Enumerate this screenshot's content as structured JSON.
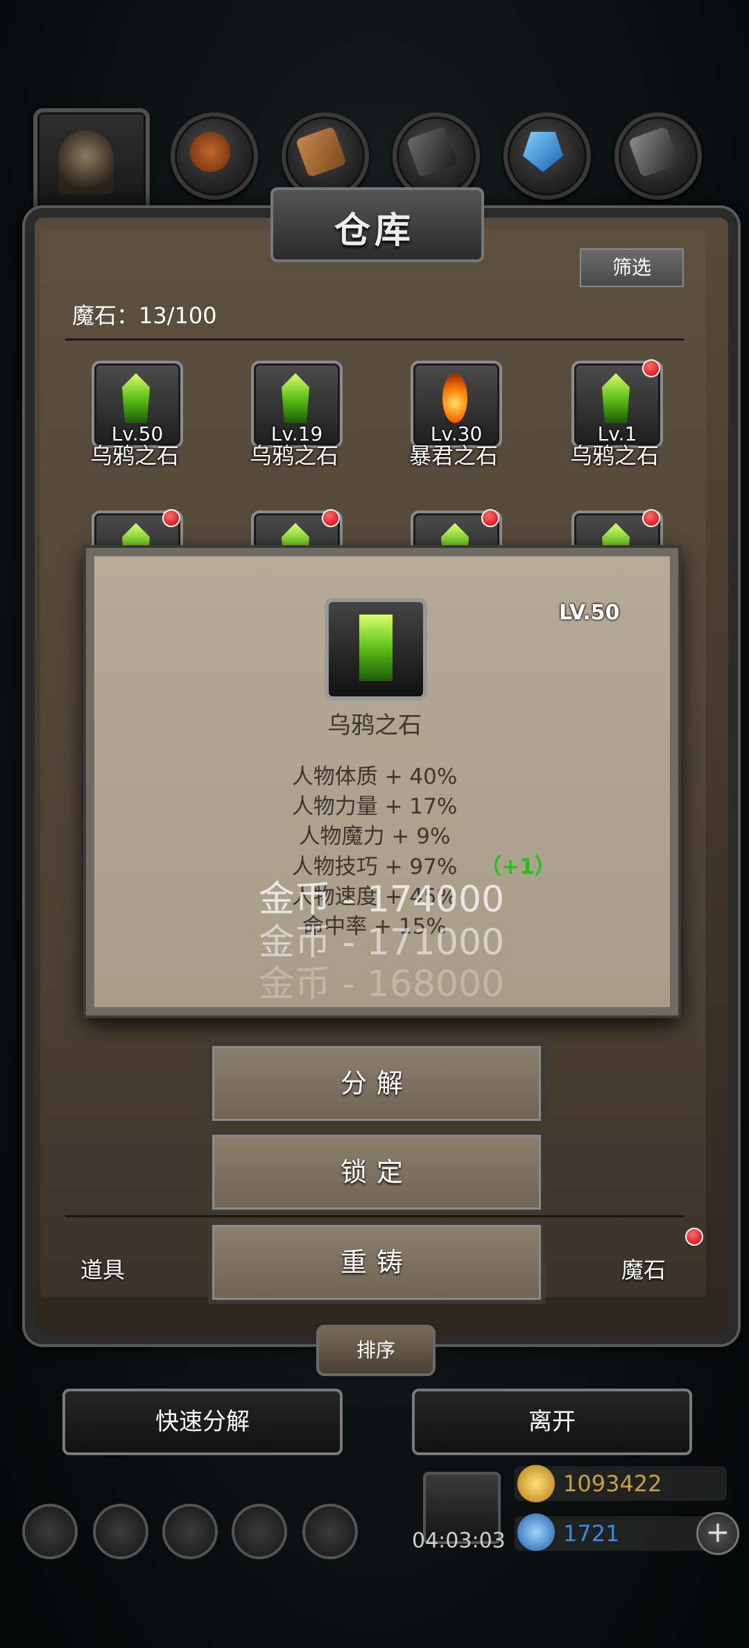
{
  "window": {
    "title": "仓库",
    "filter_label": "筛选"
  },
  "inventory": {
    "count_label": "魔石：13/100"
  },
  "top_tabs": [
    {
      "icon": "helmet-icon"
    },
    {
      "icon": "bread-icon"
    },
    {
      "icon": "wood-icon"
    },
    {
      "icon": "iron-icon"
    },
    {
      "icon": "crystal-icon"
    },
    {
      "icon": "steel-icon"
    }
  ],
  "stones_row1": [
    {
      "lvl": "Lv.50",
      "name": "乌鸦之石",
      "type": "green",
      "new": false
    },
    {
      "lvl": "Lv.19",
      "name": "乌鸦之石",
      "type": "green",
      "new": false
    },
    {
      "lvl": "Lv.30",
      "name": "暴君之石",
      "type": "fire",
      "new": false
    },
    {
      "lvl": "Lv.1",
      "name": "乌鸦之石",
      "type": "green",
      "new": true
    }
  ],
  "stones_row2": [
    {
      "type": "green",
      "new": true
    },
    {
      "type": "green",
      "new": true
    },
    {
      "type": "green",
      "new": true
    },
    {
      "type": "green",
      "new": true
    }
  ],
  "detail": {
    "level": "LV.50",
    "name": "乌鸦之石",
    "stats": [
      "人物体质 + 40%",
      "人物力量 + 17%",
      "人物魔力 + 9%",
      "人物技巧 + 97%",
      "人物速度 + 45%",
      "命中率 + 15%"
    ],
    "bonus": "（+1）"
  },
  "floating": [
    "金币 - 174000",
    "金币 - 171000",
    "金币 - 168000"
  ],
  "actions": {
    "decompose": "分解",
    "lock": "锁定",
    "reforge": "重铸"
  },
  "bottom_tabs": {
    "items": "道具",
    "stones": "魔石"
  },
  "sort_label": "排序",
  "footer": {
    "quick_decompose": "快速分解",
    "leave": "离开"
  },
  "hud": {
    "timer": "04:03:03",
    "gold": "1093422",
    "gems": "1721",
    "plus": "+"
  },
  "colors": {
    "bonus": "#1fc41f",
    "gold_text": "#c9a040",
    "gem_text": "#3a8ae0",
    "notify": "#d10000"
  }
}
